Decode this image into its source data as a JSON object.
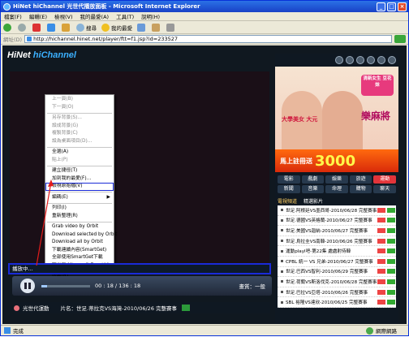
{
  "window": {
    "title": "HiNet hiChannel 光世代播放面板 - Microsoft Internet Explorer"
  },
  "menu": [
    "檔案(F)",
    "編輯(E)",
    "檢視(V)",
    "我的最愛(A)",
    "工具(T)",
    "說明(H)"
  ],
  "toolbar": {
    "search": "搜尋",
    "favorites": "我的最愛"
  },
  "address": {
    "label": "網址(D)",
    "url": "http://hichannel.hinet.net/player/ftt=f1.jsp?id=233527"
  },
  "logo": {
    "text1": "HiNet",
    "text2": "hiChannel"
  },
  "context_menu": [
    {
      "label": "上一頁(B)",
      "disabled": true
    },
    {
      "label": "下一頁(O)",
      "disabled": true
    },
    {
      "sep": true
    },
    {
      "label": "另存背景(S)...",
      "disabled": true
    },
    {
      "label": "設成背景(G)",
      "disabled": true
    },
    {
      "label": "複製背景(C)",
      "disabled": true
    },
    {
      "label": "設為桌面項目(D)...",
      "disabled": true
    },
    {
      "sep": true
    },
    {
      "label": "全選(A)"
    },
    {
      "label": "貼上(P)",
      "disabled": true
    },
    {
      "sep": true
    },
    {
      "label": "建立捷徑(T)"
    },
    {
      "label": "加到我的最愛(F)..."
    },
    {
      "label": "檢視原始檔(V)",
      "highlight": true
    },
    {
      "sep": true
    },
    {
      "label": "編碼(E)",
      "submenu": true
    },
    {
      "sep": true
    },
    {
      "label": "列印(I)"
    },
    {
      "label": "重新整理(R)"
    },
    {
      "sep": true
    },
    {
      "label": "Grab video by Orbit"
    },
    {
      "label": "Download selected by Orbit"
    },
    {
      "label": "Download all by Orbit"
    },
    {
      "label": "下載連續內容(SmartGet)"
    },
    {
      "label": "全部使用SmartGet下載"
    },
    {
      "label": "匯出至 Microsoft Excel(X)"
    },
    {
      "sep": true
    },
    {
      "label": "內容(R)"
    }
  ],
  "player": {
    "status": "播放中...",
    "time": "00 : 18 / 136 : 18",
    "volume_label": "畫質：一般",
    "progress": 0.12
  },
  "program": {
    "channel": "光世代運動",
    "title_label": "片名：",
    "title": "世足.蒂拉克VS海灣-2010/06/26 完整賽事"
  },
  "ad": {
    "tag": "清新女生 豆花妹",
    "line1": "大學美女 大元",
    "brand": "樂麻將",
    "cta": "馬上註冊送",
    "amount": "3000"
  },
  "nav": [
    {
      "label": "電影"
    },
    {
      "label": "戲劇"
    },
    {
      "label": "娛樂"
    },
    {
      "label": "旅遊"
    },
    {
      "label": "運動",
      "on": true
    },
    {
      "label": "新聞"
    },
    {
      "label": "音樂"
    },
    {
      "label": "命理"
    },
    {
      "label": "購物"
    },
    {
      "label": "聊天"
    }
  ],
  "tabs": [
    {
      "label": "電視頻道",
      "on": true
    },
    {
      "label": "精選影片"
    }
  ],
  "list": [
    "世足.阿根廷VS墨西哥-2010/06/28 完整賽事",
    "世足.德國VS英格蘭-2010/06/27 完整賽事",
    "世足.美國VS迦納-2010/06/27 完整賽事",
    "世足.烏拉圭VS南韓-2010/06/26 完整賽事",
    "運動playl吧-第22集 處處射侍韓",
    "CPBL 統一 VS 兄弟-2010/06/27 完整賽事",
    "世足.巴西VS智利-2010/06/29 完整賽事",
    "世足.荷蘭VS斯洛伐克-2010/06/28 完整賽事",
    "世足.巴拉VS亞塔-2010/06/26 完整賽事",
    "SBL 裕隆VS達欣-2010/06/25 完整賽事"
  ],
  "statusbar": {
    "left": "完成",
    "zone": "網際網路"
  }
}
